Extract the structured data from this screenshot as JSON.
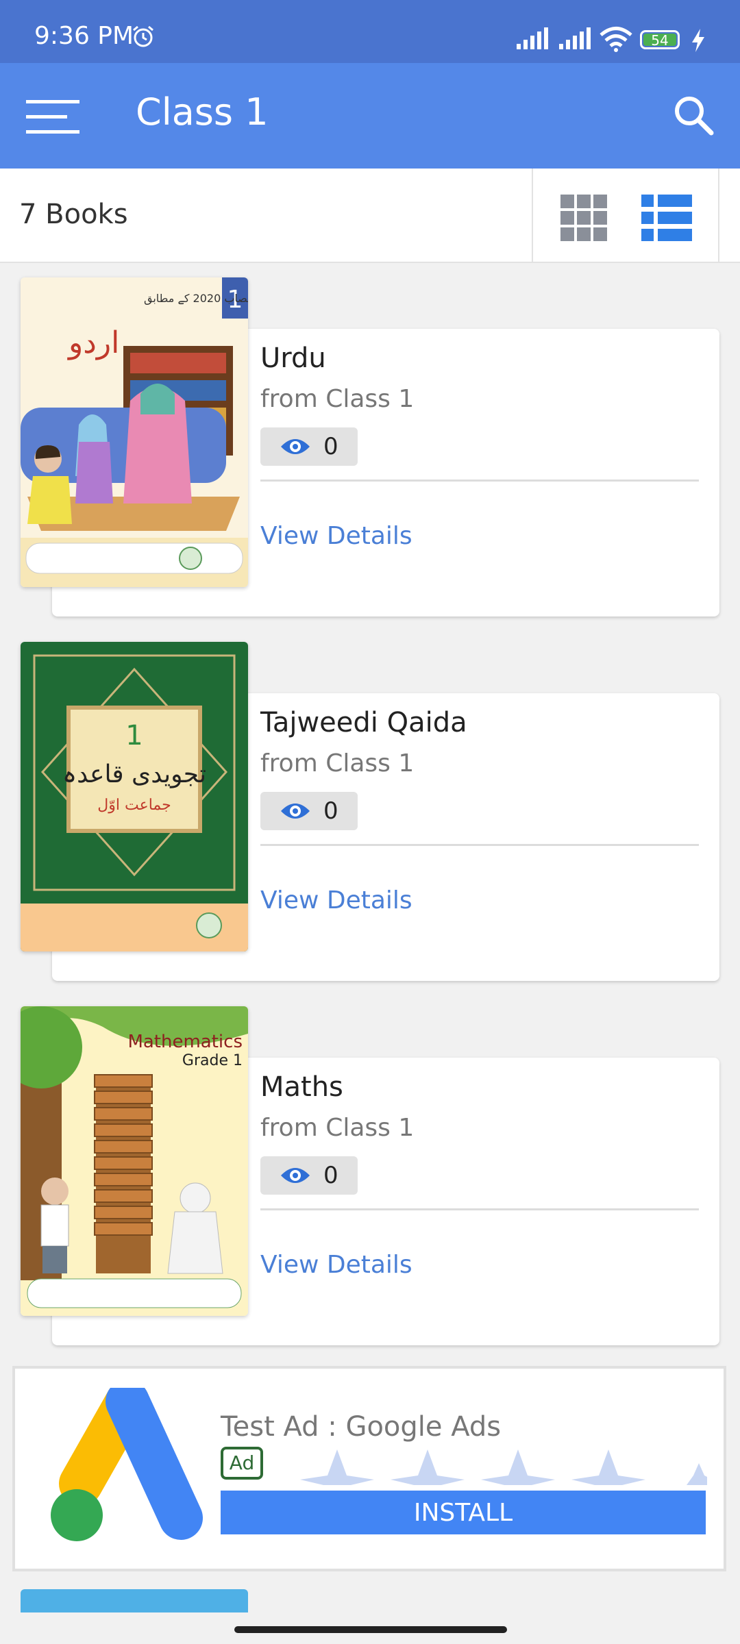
{
  "status_bar": {
    "time": "9:36 PM",
    "battery": "54"
  },
  "app_bar": {
    "title": "Class 1"
  },
  "toolbar": {
    "book_count": "7 Books"
  },
  "books": [
    {
      "title": "Urdu",
      "from": "from Class 1",
      "views": "0",
      "details": "View Details",
      "cover_number": "1"
    },
    {
      "title": "Tajweedi Qaida",
      "from": "from Class 1",
      "views": "0",
      "details": "View Details",
      "cover_number": "1"
    },
    {
      "title": "Maths",
      "from": "from Class 1",
      "views": "0",
      "details": "View Details",
      "cover_title": "Mathematics",
      "cover_grade": "Grade 1"
    }
  ],
  "ad": {
    "headline": "Test Ad : Google Ads",
    "badge": "Ad",
    "button": "INSTALL"
  },
  "colors": {
    "app_bar": "#5488e8",
    "status_bar": "#4a74cf",
    "accent": "#4a7fd6"
  }
}
